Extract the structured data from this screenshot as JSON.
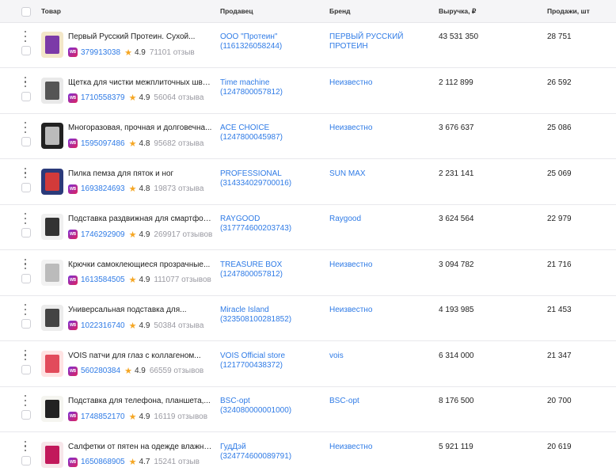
{
  "header": {
    "product": "Товар",
    "seller": "Продавец",
    "brand": "Бренд",
    "revenue": "Выручка, ₽",
    "sales": "Продажи, шт"
  },
  "badge_text": "WB",
  "colors": {
    "link": "#2f7be6",
    "star": "#f5a623",
    "muted": "#9a9aa2",
    "header_bg": "#f5f5f7"
  },
  "rows": [
    {
      "name": "Первый Русский Протеин. Сухой...",
      "sku": "379913038",
      "rating": "4.9",
      "reviews": "71101 отзыв",
      "seller": "ООО \"Протеин\"",
      "seller_id": "(1161326058244)",
      "brand": "ПЕРВЫЙ РУССКИЙ ПРОТЕИН",
      "revenue": "43 531 350",
      "sales": "28 751"
    },
    {
      "name": "Щетка для чистки межплиточных шво...",
      "sku": "1710558379",
      "rating": "4.9",
      "reviews": "56064 отзыва",
      "seller": "Time machine",
      "seller_id": "(1247800057812)",
      "brand": "Неизвестно",
      "revenue": "2 112 899",
      "sales": "26 592"
    },
    {
      "name": "Многоразовая, прочная и долговечна...",
      "sku": "1595097486",
      "rating": "4.8",
      "reviews": "95682 отзыва",
      "seller": "ACE CHOICE",
      "seller_id": "(1247800045987)",
      "brand": "Неизвестно",
      "revenue": "3 676 637",
      "sales": "25 086"
    },
    {
      "name": "Пилка пемза для пяток и ног",
      "sku": "1693824693",
      "rating": "4.8",
      "reviews": "19873 отзыва",
      "seller": "PROFESSIONAL",
      "seller_id": "(314334029700016)",
      "brand": "SUN MAX",
      "revenue": "2 231 141",
      "sales": "25 069"
    },
    {
      "name": "Подставка раздвижная для смартфон...",
      "sku": "1746292909",
      "rating": "4.9",
      "reviews": "269917 отзывов",
      "seller": "RAYGOOD",
      "seller_id": "(317774600203743)",
      "brand": "Raygood",
      "revenue": "3 624 564",
      "sales": "22 979"
    },
    {
      "name": "Крючки самоклеющиеся прозрачные...",
      "sku": "1613584505",
      "rating": "4.9",
      "reviews": "111077 отзывов",
      "seller": "TREASURE BOX",
      "seller_id": "(1247800057812)",
      "brand": "Неизвестно",
      "revenue": "3 094 782",
      "sales": "21 716"
    },
    {
      "name": "Универсальная подставка для...",
      "sku": "1022316740",
      "rating": "4.9",
      "reviews": "50384 отзыва",
      "seller": "Miracle Island",
      "seller_id": "(323508100281852)",
      "brand": "Неизвестно",
      "revenue": "4 193 985",
      "sales": "21 453"
    },
    {
      "name": "VOIS патчи для глаз с коллагеном...",
      "sku": "560280384",
      "rating": "4.9",
      "reviews": "66559 отзывов",
      "seller": "VOIS Official store",
      "seller_id": "(1217700438372)",
      "brand": "vois",
      "revenue": "6 314 000",
      "sales": "21 347"
    },
    {
      "name": "Подставка для телефона, планшета,...",
      "sku": "1748852170",
      "rating": "4.9",
      "reviews": "16119 отзывов",
      "seller": "BSC-opt",
      "seller_id": "(324080000001000)",
      "brand": "BSC-opt",
      "revenue": "8 176 500",
      "sales": "20 700"
    },
    {
      "name": "Салфетки от пятен на одежде влажны...",
      "sku": "1650868905",
      "rating": "4.7",
      "reviews": "15241 отзыв",
      "seller": "ГудДэй",
      "seller_id": "(324774600089791)",
      "brand": "Неизвестно",
      "revenue": "5 921 119",
      "sales": "20 619"
    }
  ]
}
